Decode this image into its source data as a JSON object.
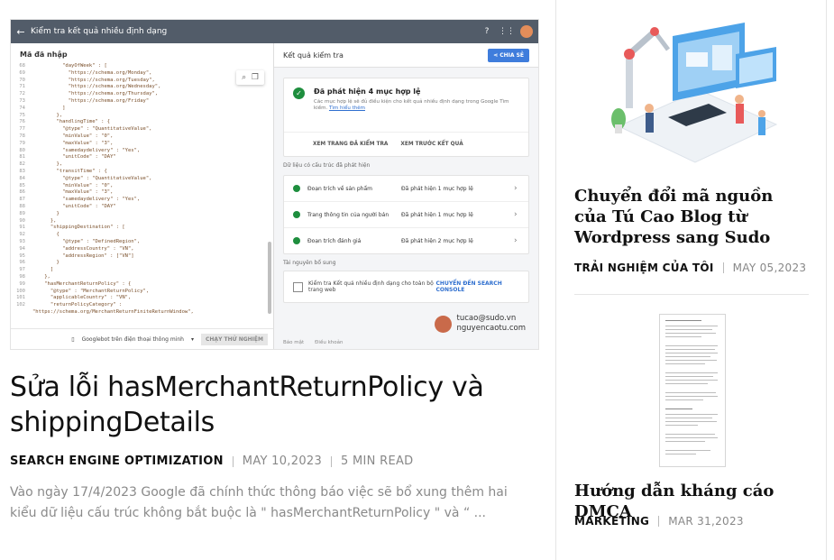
{
  "main_post": {
    "thumbnail": {
      "window_title": "Kiểm tra kết quả nhiều định dạng",
      "code_pane_title": "Mã đã nhập",
      "code_lines": [
        {
          "n": "68",
          "t": "          \"dayOfWeek\" : ["
        },
        {
          "n": "69",
          "t": "            \"https://schema.org/Monday\","
        },
        {
          "n": "70",
          "t": "            \"https://schema.org/Tuesday\","
        },
        {
          "n": "71",
          "t": "            \"https://schema.org/Wednesday\","
        },
        {
          "n": "72",
          "t": "            \"https://schema.org/Thursday\","
        },
        {
          "n": "73",
          "t": "            \"https://schema.org/Friday\""
        },
        {
          "n": "74",
          "t": "          ]"
        },
        {
          "n": "75",
          "t": "        },"
        },
        {
          "n": "76",
          "t": "        \"handlingTime\" : {"
        },
        {
          "n": "77",
          "t": "          \"@type\" : \"QuantitativeValue\","
        },
        {
          "n": "78",
          "t": "          \"minValue\" : \"0\","
        },
        {
          "n": "79",
          "t": "          \"maxValue\" : \"3\","
        },
        {
          "n": "80",
          "t": "          \"samedaydelivery\" : \"Yes\","
        },
        {
          "n": "81",
          "t": "          \"unitCode\" : \"DAY\""
        },
        {
          "n": "82",
          "t": "        },"
        },
        {
          "n": "83",
          "t": "        \"transitTime\" : {"
        },
        {
          "n": "84",
          "t": "          \"@type\" : \"QuantitativeValue\","
        },
        {
          "n": "85",
          "t": "          \"minValue\" : \"0\","
        },
        {
          "n": "86",
          "t": "          \"maxValue\" : \"3\","
        },
        {
          "n": "87",
          "t": "          \"samedaydelivery\" : \"Yes\","
        },
        {
          "n": "88",
          "t": "          \"unitCode\" : \"DAY\""
        },
        {
          "n": "89",
          "t": "        }"
        },
        {
          "n": "90",
          "t": "      },"
        },
        {
          "n": "91",
          "t": "      \"shippingDestination\" : ["
        },
        {
          "n": "92",
          "t": "        {"
        },
        {
          "n": "93",
          "t": "          \"@type\" : \"DefinedRegion\","
        },
        {
          "n": "94",
          "t": "          \"addressCountry\" : \"VN\","
        },
        {
          "n": "95",
          "t": "          \"addressRegion\" : [\"VN\"]"
        },
        {
          "n": "96",
          "t": "        }"
        },
        {
          "n": "97",
          "t": "      ]"
        },
        {
          "n": "98",
          "t": "    },"
        },
        {
          "n": "99",
          "t": "    \"hasMerchantReturnPolicy\" : {"
        },
        {
          "n": "100",
          "t": "      \"@type\" : \"MerchantReturnPolicy\","
        },
        {
          "n": "101",
          "t": "      \"applicableCountry\" : \"VN\","
        },
        {
          "n": "102",
          "t": "      \"returnPolicyCategory\" :"
        },
        {
          "n": "",
          "t": "\"https://schema.org/MerchantReturnFiniteReturnWindow\","
        }
      ],
      "code_footer_agent": "Googlebot trên điện thoại thông minh",
      "test_button": "CHẠY THỬ NGHIỆM",
      "result_pane_title": "Kết quả kiểm tra",
      "share_button": "CHIA SẺ",
      "valid_title": "Đã phát hiện 4 mục hợp lệ",
      "valid_desc": "Các mục hợp lệ sẽ đủ điều kiện cho kết quả nhiều định dạng trong Google Tìm kiếm.",
      "valid_desc_link": "Tìm hiểu thêm",
      "action_view_tested": "XEM TRANG ĐÃ KIỂM TRA",
      "action_preview": "XEM TRƯỚC KẾT QUẢ",
      "structured_data_label": "Dữ liệu có cấu trúc đã phát hiện",
      "items": [
        {
          "name": "Đoạn trích về sản phẩm",
          "count": "Đã phát hiện 1 mục hợp lệ"
        },
        {
          "name": "Trang thông tin của người bán",
          "count": "Đã phát hiện 1 mục hợp lệ"
        },
        {
          "name": "Đoạn trích đánh giá",
          "count": "Đã phát hiện 2 mục hợp lệ"
        }
      ],
      "extra_label": "Tài nguyên bổ sung",
      "extra_text": "Kiểm tra Kết quả nhiều định dạng cho toàn bộ trang web",
      "extra_link": "CHUYỂN ĐẾN SEARCH CONSOLE",
      "author_email": "tucao@sudo.vn",
      "author_site": "nguyencaotu.com",
      "footer_links": [
        "Báo mật",
        "Điều khoản"
      ]
    },
    "title": "Sửa lỗi hasMerchantReturnPolicy và shippingDetails",
    "category": "SEARCH ENGINE OPTIMIZATION",
    "date": "MAY 10,2023",
    "read_time": "5 MIN READ",
    "excerpt": "Vào ngày 17/4/2023 Google đã chính thức thông báo việc sẽ bổ xung thêm hai kiểu dữ liệu cấu trúc không bắt buộc là \" hasMerchantReturnPolicy \" và “ ..."
  },
  "sidebar": {
    "posts": [
      {
        "title": "Chuyển đổi mã nguồn của Tú Cao Blog từ Wordpress sang Sudo",
        "category": "TRẢI NGHIỆM CỦA TÔI",
        "date": "MAY 05,2023"
      },
      {
        "title": "Hướng dẫn kháng cáo DMCA",
        "category": "MARKETING",
        "date": "MAR 31,2023"
      }
    ]
  },
  "colors": {
    "gsc_header": "#525c69",
    "valid_green": "#1e8e3e",
    "link_blue": "#3f7ddc",
    "meta_gray": "#888888",
    "illustration_blue": "#4da3e8"
  }
}
